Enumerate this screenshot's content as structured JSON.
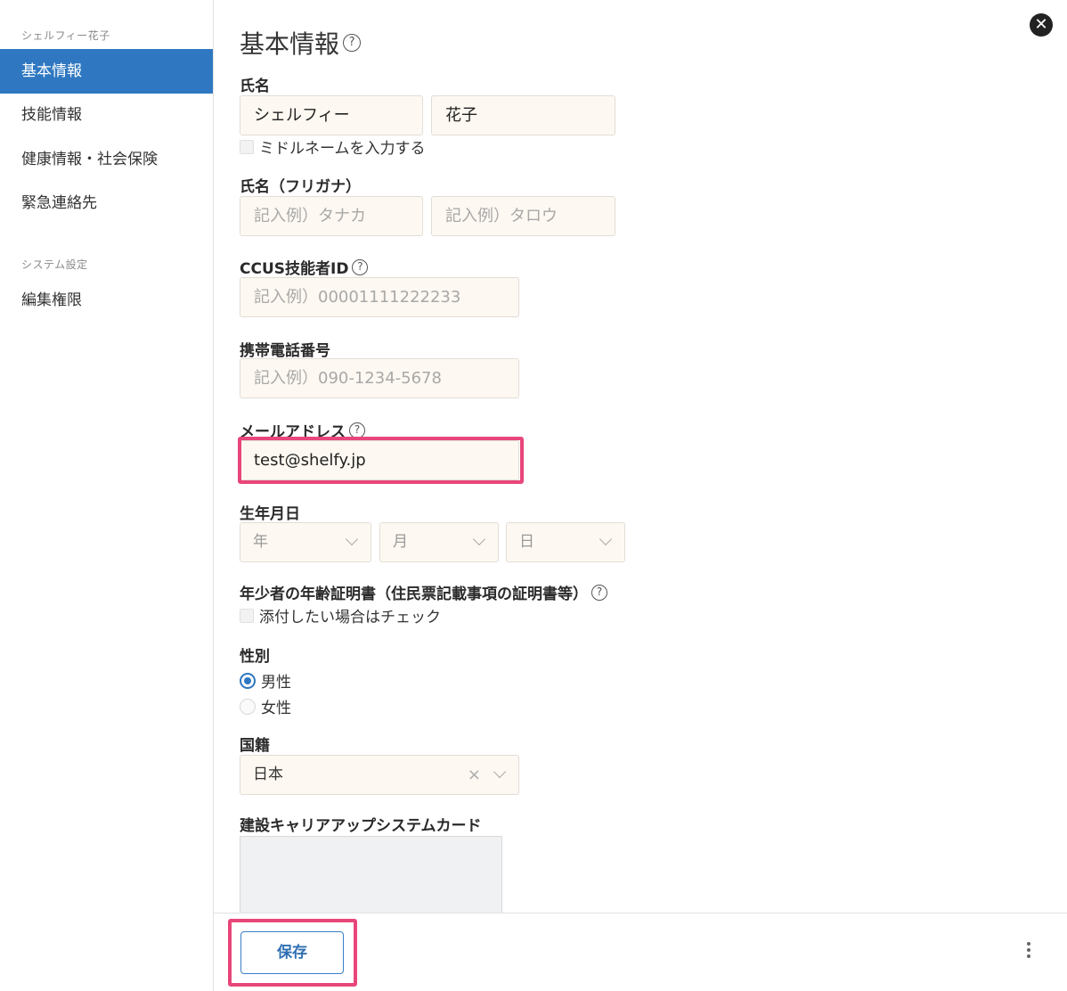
{
  "sidebar": {
    "group1": "シェルフィー花子",
    "items": [
      {
        "label": "基本情報"
      },
      {
        "label": "技能情報"
      },
      {
        "label": "健康情報・社会保険"
      },
      {
        "label": "緊急連絡先"
      }
    ],
    "group2": "システム設定",
    "items2": [
      {
        "label": "編集権限"
      }
    ]
  },
  "main": {
    "title": "基本情報",
    "help": "?",
    "close": "✕"
  },
  "form": {
    "name": {
      "label": "氏名",
      "last": "シェルフィー",
      "first": "花子",
      "middle_checkbox": "ミドルネームを入力する"
    },
    "kana": {
      "label": "氏名（フリガナ）",
      "last_placeholder": "記入例）タナカ",
      "first_placeholder": "記入例）タロウ"
    },
    "ccus": {
      "label": "CCUS技能者ID",
      "placeholder": "記入例）00001111222233"
    },
    "phone": {
      "label": "携帯電話番号",
      "placeholder": "記入例）090-1234-5678"
    },
    "email": {
      "label": "メールアドレス",
      "value": "test@shelfy.jp"
    },
    "birth": {
      "label": "生年月日",
      "year": "年",
      "month": "月",
      "day": "日"
    },
    "minor_cert": {
      "label": "年少者の年齢証明書（住民票記載事項の証明書等）",
      "checkbox": "添付したい場合はチェック"
    },
    "gender": {
      "label": "性別",
      "options": [
        "男性",
        "女性"
      ],
      "selected": "男性"
    },
    "nationality": {
      "label": "国籍",
      "value": "日本",
      "clear": "×"
    },
    "ccus_card": {
      "label": "建設キャリアアップシステムカード"
    }
  },
  "footer": {
    "save_label": "保存"
  },
  "colors": {
    "accent": "#2f78c1",
    "input_bg": "#fdf8f1",
    "highlight": "#e8467a"
  }
}
